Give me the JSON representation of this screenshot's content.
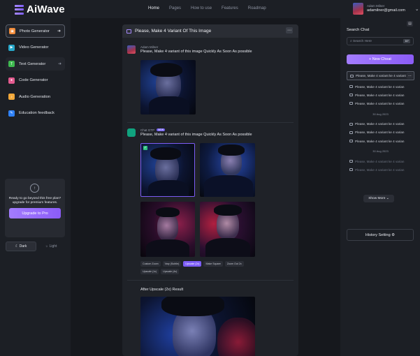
{
  "brand": {
    "name": "AiWave"
  },
  "nav": [
    "Home",
    "Pages",
    "How to use",
    "Features",
    "Roadmap"
  ],
  "user": {
    "name": "Adam Milner",
    "email": "adamilner@gmail.com"
  },
  "sidebar": {
    "items": [
      {
        "label": "Photo Generator",
        "color": "#f28c3a",
        "active": true
      },
      {
        "label": "Video Generator",
        "color": "#27a7c9"
      },
      {
        "label": "Text Generator",
        "color": "#3fb950",
        "hover": true
      },
      {
        "label": "Code Generator",
        "color": "#e35b8f"
      },
      {
        "label": "Audio Generation",
        "color": "#f2a83a"
      },
      {
        "label": "Education feedback",
        "color": "#2f81f7"
      }
    ],
    "promo_text": "Ready to go beyond this free plan? upgrade for premium features.",
    "upgrade_label": "Upgrade to Pro",
    "theme_dark": "Dark",
    "theme_light": "Light"
  },
  "chat": {
    "title": "Please, Make 4 Variant Of This Image",
    "user_name": "Adam Milner",
    "user_message": "Please, Make 4 variant of this image Quickly As Soon As possible",
    "bot_name": "Chat GTP",
    "bot_badge": "NEW",
    "bot_message": "Please, Make 4 variant of this image Quickly As Soon As possible",
    "actions": [
      "Custom Zoom",
      "Vary (Subtle)",
      "Upscale (2x)",
      "Make Square",
      "Zoom Out 2x",
      "Upscale (1x)",
      "Upscale (4x)"
    ],
    "active_action": "Upscale (2x)",
    "result_label": "After Upscale (2x)  Result"
  },
  "history": {
    "title": "Search Chat",
    "search_placeholder": "Search Here",
    "search_shortcut": "⌘F",
    "new_label": "+  New Cheat",
    "items_a": [
      "Please, Make 4 variant ke 4 variant",
      "Please, Make 4 variant ke 4 varian",
      "Please, Make 4 variant ke 4 varian",
      "Please, Make 4 variant ke 4 varian"
    ],
    "date_1": "30 Aug 2023",
    "items_b": [
      "Please, Make 4 variant ke 4 varian",
      "Please, Make 4 variant ke 4 varian",
      "Please, Make 4 variant ke 4 varian"
    ],
    "date_2": "30 Aug 2023",
    "items_c": [
      "Please, Make 4 variant ke 4 varian",
      "Please, Make 4 variant ke 4 varian"
    ],
    "show_more": "Show More",
    "setting_label": "History Setting"
  }
}
